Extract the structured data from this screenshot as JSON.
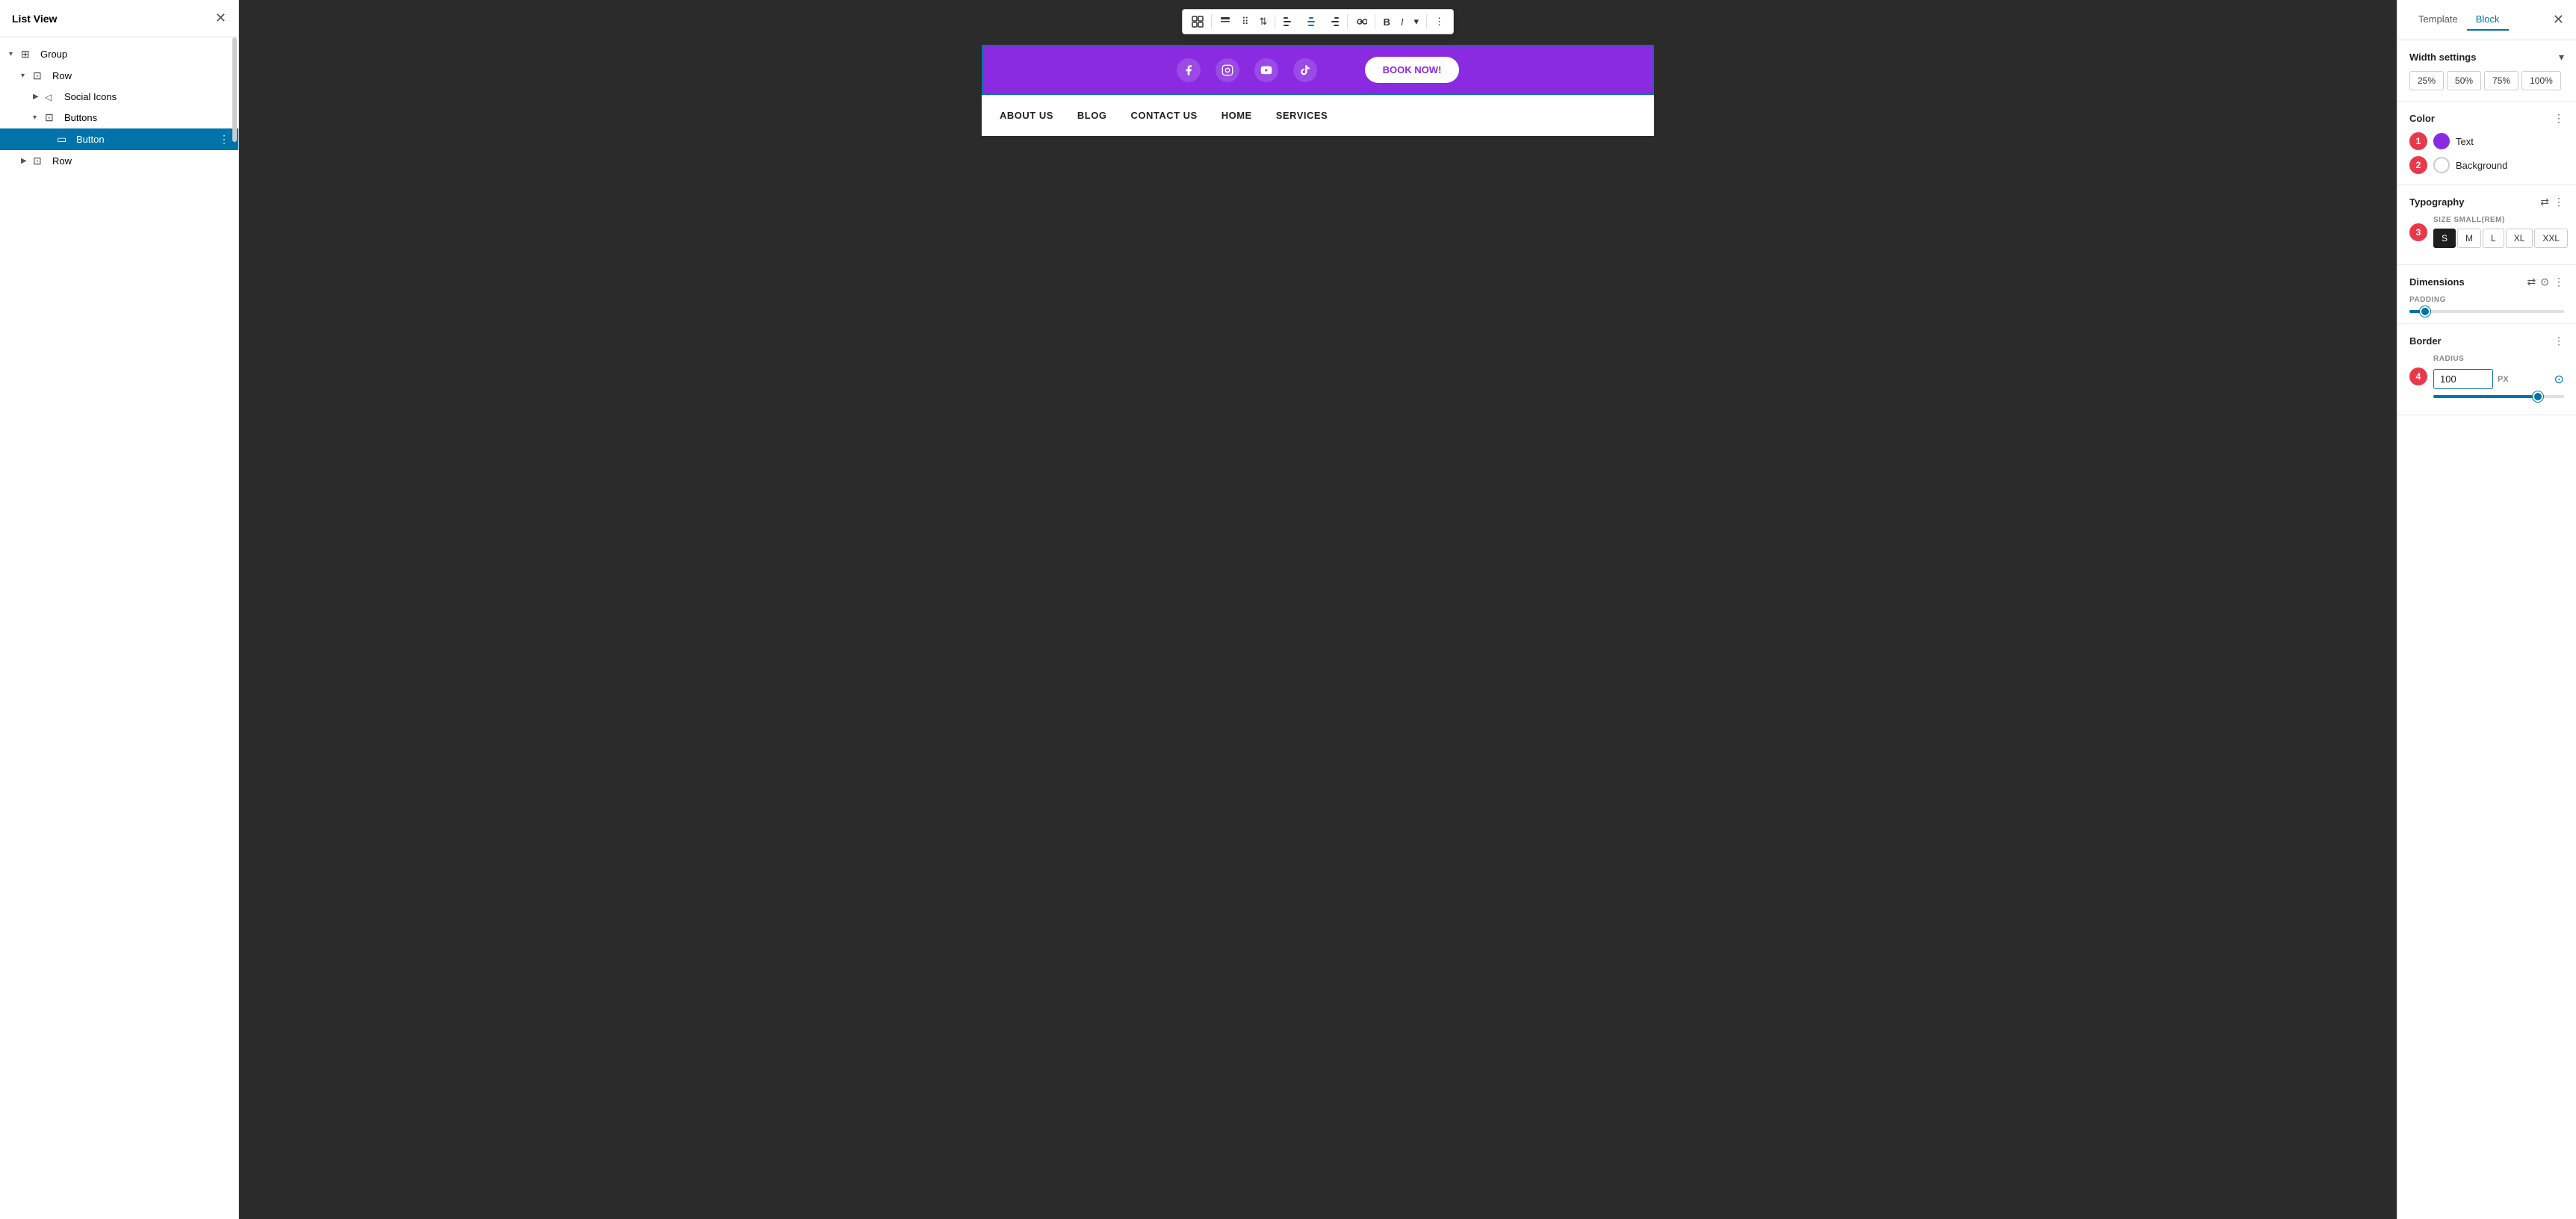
{
  "leftPanel": {
    "title": "List View",
    "tree": [
      {
        "id": "group",
        "label": "Group",
        "indent": 0,
        "icon": "⊞",
        "chevron": "▾",
        "selected": false
      },
      {
        "id": "row1",
        "label": "Row",
        "indent": 1,
        "icon": "⊡",
        "chevron": "▾",
        "selected": false
      },
      {
        "id": "social-icons",
        "label": "Social Icons",
        "indent": 2,
        "icon": "◁",
        "chevron": "▶",
        "selected": false
      },
      {
        "id": "buttons",
        "label": "Buttons",
        "indent": 2,
        "icon": "⊡",
        "chevron": "▾",
        "selected": false
      },
      {
        "id": "button",
        "label": "Button",
        "indent": 3,
        "icon": "▭",
        "chevron": "",
        "selected": true
      },
      {
        "id": "row2",
        "label": "Row",
        "indent": 1,
        "icon": "⊡",
        "chevron": "▶",
        "selected": false
      }
    ]
  },
  "canvas": {
    "socialIcons": [
      "facebook",
      "instagram",
      "youtube",
      "tiktok"
    ],
    "bookNowLabel": "BOOK NOW!",
    "navItems": [
      "ABOUT US",
      "BLOG",
      "CONTACT US",
      "HOME",
      "SERVICES"
    ]
  },
  "toolbar": {
    "buttons": [
      "grid",
      "text",
      "drag",
      "up-down",
      "align-left",
      "center",
      "align-right",
      "link",
      "bold",
      "italic",
      "dropdown",
      "more"
    ]
  },
  "rightPanel": {
    "tabs": [
      {
        "id": "template",
        "label": "Template"
      },
      {
        "id": "block",
        "label": "Block"
      }
    ],
    "activeTab": "Block",
    "widthSettings": {
      "title": "Width settings",
      "options": [
        "25%",
        "50%",
        "75%",
        "100%"
      ]
    },
    "color": {
      "title": "Color",
      "badge": "1",
      "items": [
        {
          "id": "text-color",
          "label": "Text",
          "colorClass": "purple",
          "badge": "1"
        },
        {
          "id": "bg-color",
          "label": "Background",
          "colorClass": "white",
          "badge": "2"
        }
      ]
    },
    "typography": {
      "title": "Typography",
      "badge": "3",
      "sizeLabel": "SIZE SMALL(REM)",
      "sizes": [
        "S",
        "M",
        "L",
        "XL",
        "XXL"
      ],
      "activeSize": "S"
    },
    "dimensions": {
      "title": "Dimensions",
      "paddingLabel": "PADDING",
      "paddingValue": 0
    },
    "border": {
      "title": "Border",
      "badge": "4",
      "radiusLabel": "RADIUS",
      "radiusValue": "100",
      "radiusUnit": "PX"
    }
  }
}
